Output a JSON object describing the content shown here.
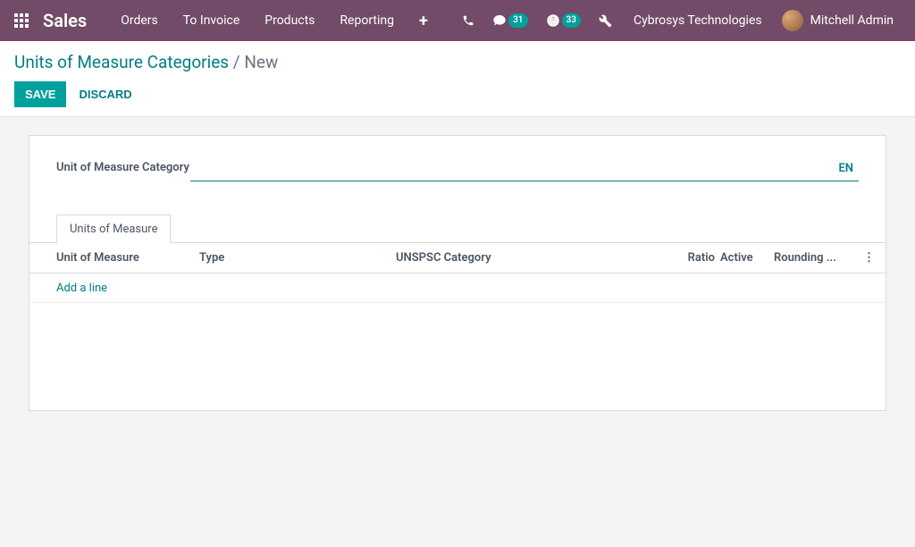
{
  "topbar": {
    "brand": "Sales",
    "nav": [
      "Orders",
      "To Invoice",
      "Products",
      "Reporting"
    ],
    "messages_badge": "31",
    "activities_badge": "33",
    "company": "Cybrosys Technologies",
    "user": "Mitchell Admin"
  },
  "breadcrumb": {
    "root": "Units of Measure Categories",
    "separator": " / ",
    "current": "New"
  },
  "buttons": {
    "save": "SAVE",
    "discard": "DISCARD"
  },
  "form": {
    "category_label": "Unit of Measure Category",
    "category_value": "",
    "lang": "EN"
  },
  "tab": {
    "label": "Units of Measure"
  },
  "table": {
    "columns": {
      "uom": "Unit of Measure",
      "type": "Type",
      "unspsc": "UNSPSC Category",
      "ratio": "Ratio",
      "active": "Active",
      "rounding": "Rounding ..."
    },
    "add_line": "Add a line"
  }
}
